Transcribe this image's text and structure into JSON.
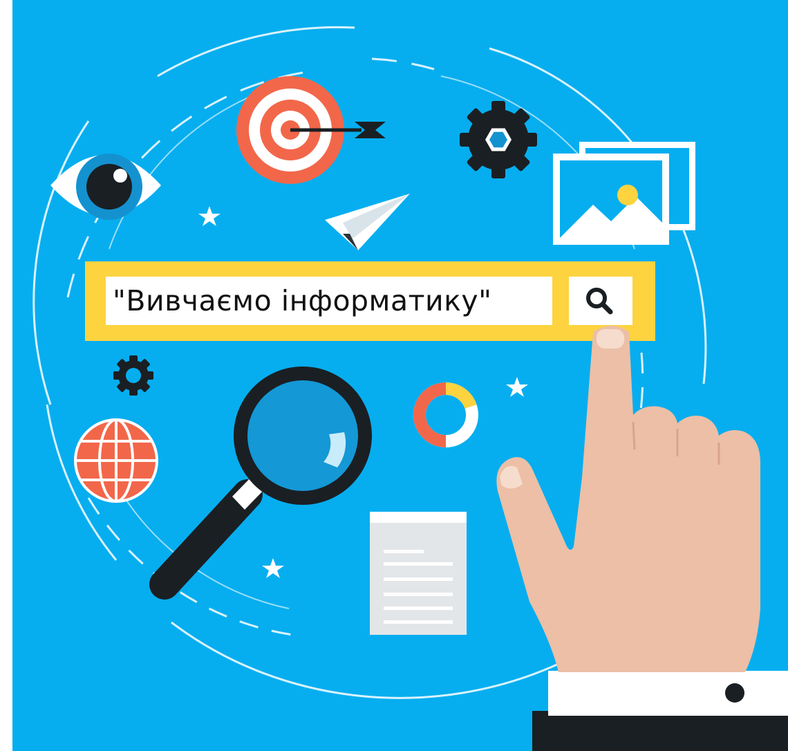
{
  "search": {
    "query": "\"Вивчаємо інформатику\"",
    "button_icon": "search-icon"
  },
  "colors": {
    "background": "#06aeef",
    "search_bar": "#fdd33f",
    "target_red": "#f2674a",
    "skin": "#ecbfa6",
    "dark": "#1a1f23"
  },
  "icons": [
    "eye-icon",
    "target-icon",
    "arrow-icon",
    "gear-icon",
    "picture-icon",
    "paper-plane-icon",
    "star-icon",
    "globe-icon",
    "magnifier-icon",
    "donut-chart-icon",
    "document-icon",
    "pointing-hand-icon"
  ]
}
